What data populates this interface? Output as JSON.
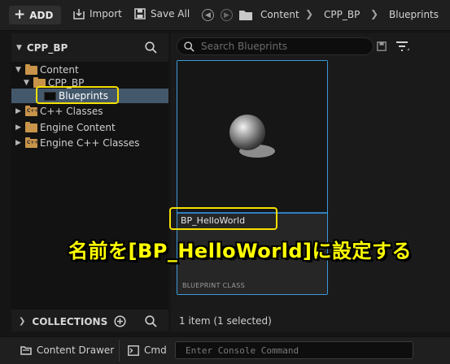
{
  "toolbar": {
    "add_label": "ADD",
    "import_label": "Import",
    "save_all_label": "Save All",
    "breadcrumb": [
      "Content",
      "CPP_BP",
      "Blueprints"
    ]
  },
  "left_panel": {
    "title": "CPP_BP",
    "tree": [
      {
        "label": "Content",
        "icon": "folder-open-icon"
      },
      {
        "label": "CPP_BP",
        "icon": "folder-open-icon"
      },
      {
        "label": "Blueprints",
        "icon": "folder-icon",
        "selected": true
      },
      {
        "label": "C++ Classes",
        "icon": "cpp-folder-icon"
      },
      {
        "label": "Engine Content",
        "icon": "folder-icon"
      },
      {
        "label": "Engine C++ Classes",
        "icon": "cpp-folder-icon"
      }
    ],
    "collections_label": "COLLECTIONS"
  },
  "right_panel": {
    "search_placeholder": "Search Blueprints",
    "asset": {
      "name": "BP_HelloWorld",
      "class": "BLUEPRINT CLASS"
    },
    "status": "1 item (1 selected)"
  },
  "bottom_bar": {
    "content_drawer_label": "Content Drawer",
    "cmd_label": "Cmd",
    "console_placeholder": "Enter Console Command"
  },
  "caption": "名前を[BP_HelloWorld]に設定する",
  "colors": {
    "accent": "#3a9ad9",
    "highlight": "#f5e000",
    "folder": "#c8944a",
    "selection": "#43586a"
  }
}
